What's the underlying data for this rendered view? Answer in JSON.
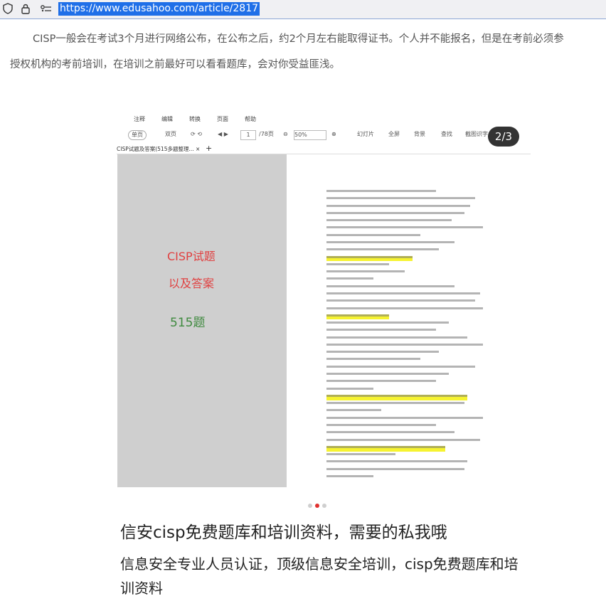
{
  "browser": {
    "url": "https://www.edusahoo.com/article/2817",
    "icons": [
      "shield-icon",
      "lock-icon",
      "permissions-icon"
    ]
  },
  "article": {
    "paragraph_line1": "CISP一般会在考试3个月进行网络公布，在公布之后，约2个月左右能取得证书。个人并不能报名，但是在考前必须参",
    "paragraph_line2": "授权机构的考前培训，在培训之前最好可以看看题库，会对你受益匪浅。"
  },
  "carousel": {
    "counter": "2/3",
    "dots": 3,
    "active_dot": 2,
    "slide": {
      "menu": [
        "注释",
        "编辑",
        "转换",
        "页面",
        "帮助"
      ],
      "toolbar": {
        "single_page": "单页",
        "double_page": "双页",
        "page_input": "1",
        "page_total": "/78页",
        "zoom": "50%",
        "slideshow": "幻灯片",
        "fullscreen": "全屏",
        "background": "背景",
        "find": "查找",
        "screenshot": "截图识字"
      },
      "tab": "CISP试题及答案(515多题整理... ×",
      "cover": {
        "title": "CISP试题",
        "subtitle": "以及答案",
        "count": "515题"
      }
    }
  },
  "headings": {
    "main": "信安cisp免费题库和培训资料，需要的私我哦",
    "sub": "信息安全专业人员认证，顶级信息安全培训，cisp免费题库和培训资料"
  },
  "colors": {
    "url_highlight": "#1f6fe8",
    "cover_title": "#e04040",
    "cover_count": "#3f8a3f",
    "highlight": "#f6f330",
    "active_dot": "#e0322f"
  }
}
